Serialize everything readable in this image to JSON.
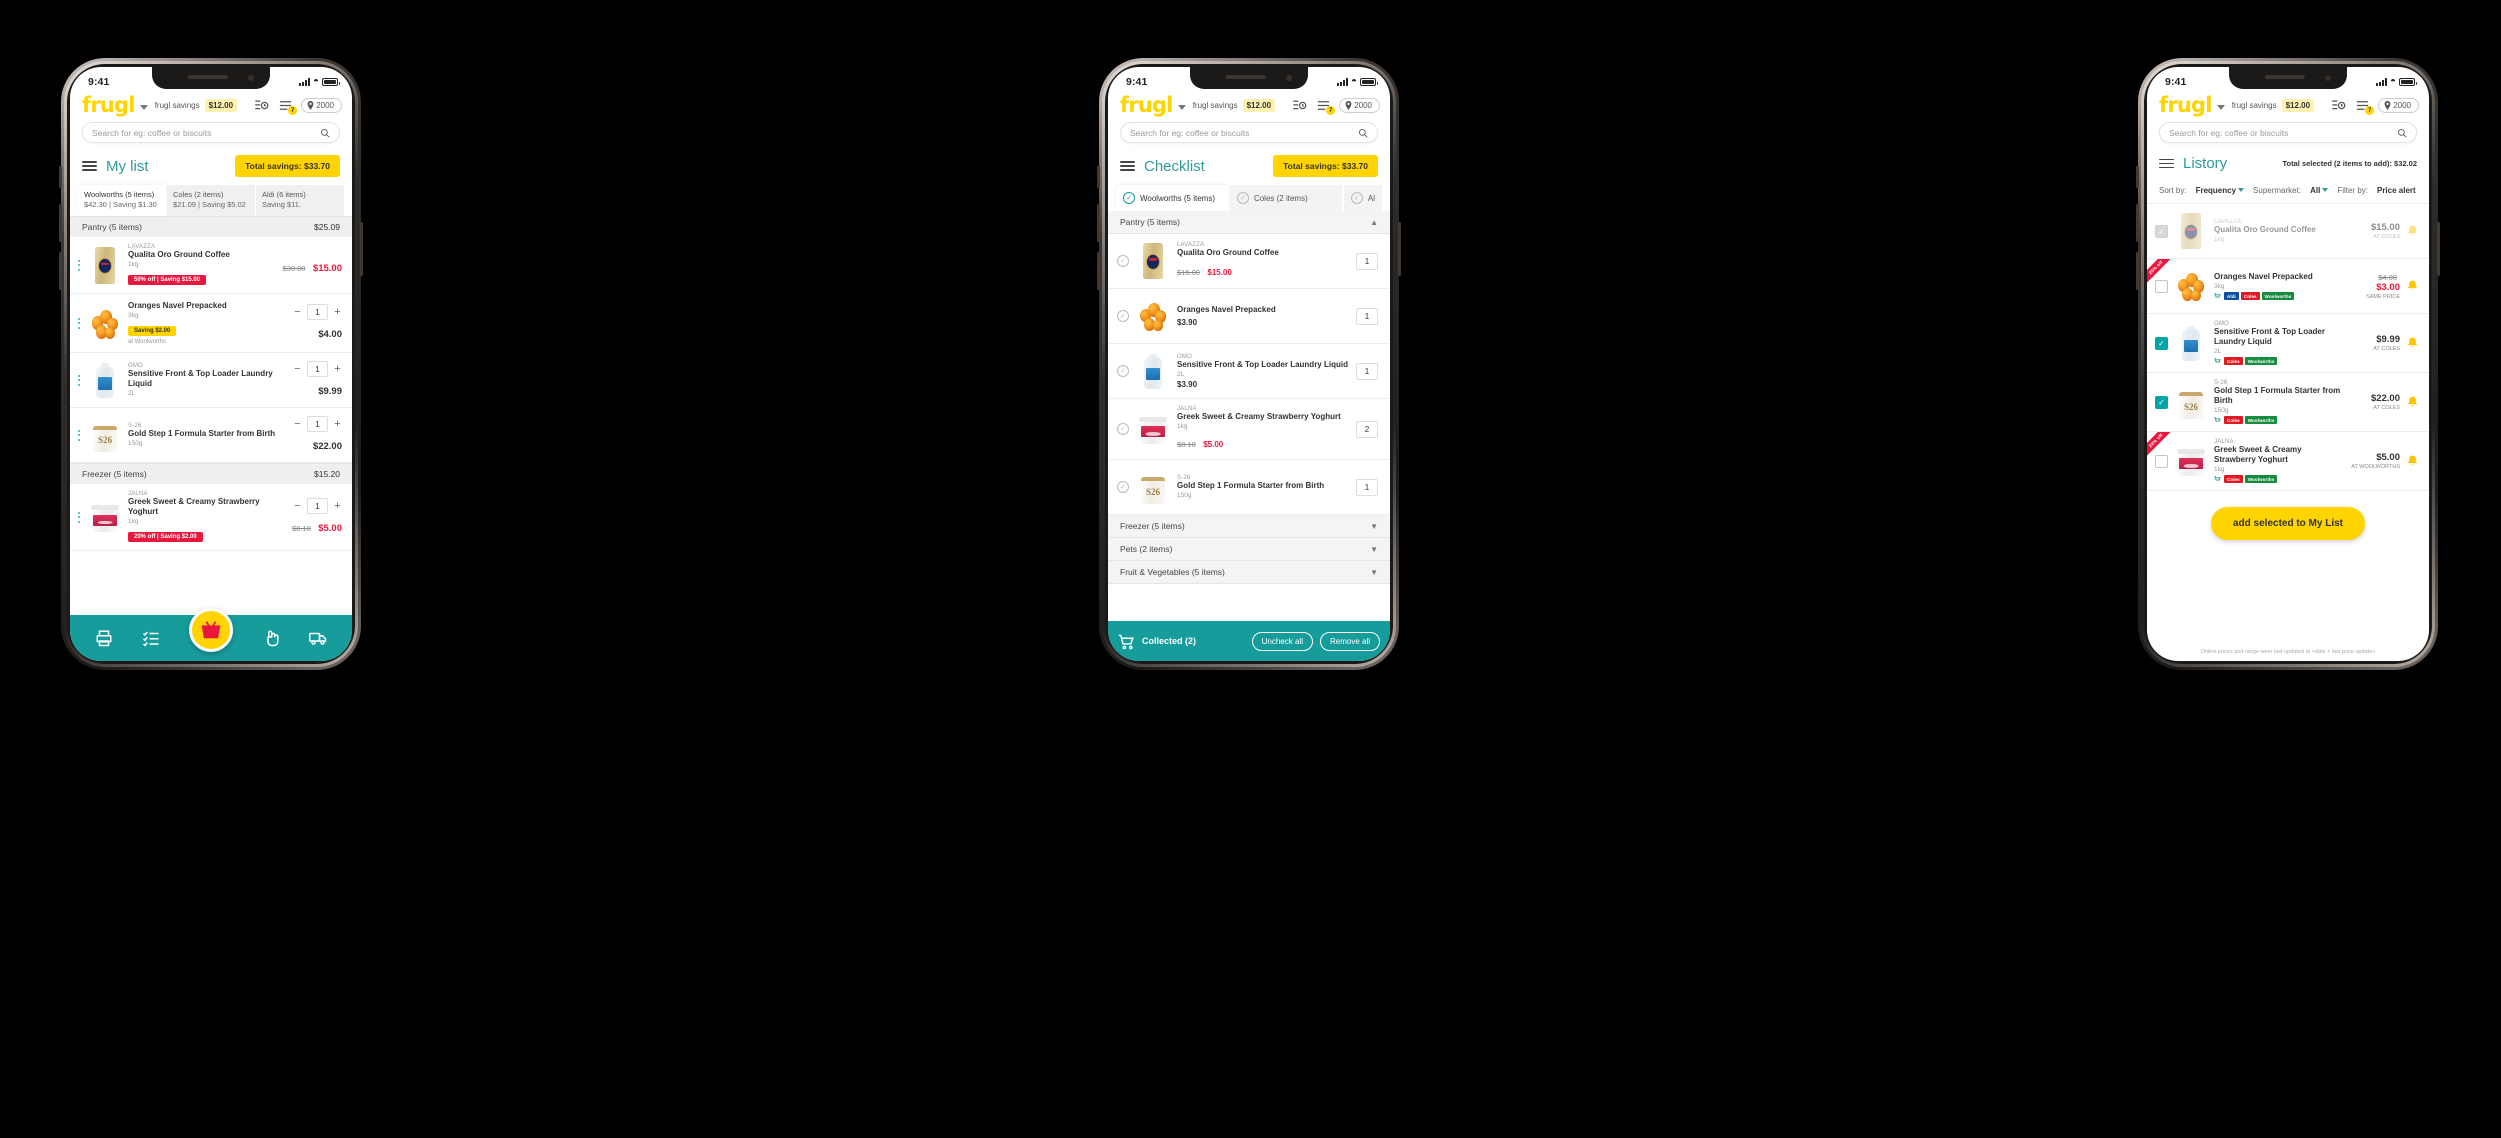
{
  "app": {
    "logo": "frugl",
    "savings_label": "frugl savings",
    "savings_amount": "$12.00",
    "postcode": "2000",
    "search_placeholder": "Search for eg: coffee or biscuits",
    "list_badge": "7",
    "cart_badge": "7",
    "status_time": "9:41",
    "accent_teal": "#179C9C",
    "accent_yellow": "#FFD400",
    "accent_red": "#E8173D"
  },
  "phone1": {
    "title": "My list",
    "savings_button": "Total savings: $33.70",
    "store_tabs": [
      {
        "name": "Woolworths (5 items)",
        "detail": "$42.30 | Saving $1.30",
        "active": true
      },
      {
        "name": "Coles (2 items)",
        "detail": "$21.09 | Saving $5.02",
        "active": false
      },
      {
        "name": "Aldi (6 items)",
        "detail": "Saving $11.",
        "active": false
      }
    ],
    "categories": [
      {
        "name": "Pantry (5 items)",
        "total": "$25.09",
        "items": [
          {
            "brand": "LAVAZZA",
            "name": "Qualita Oro Ground Coffee",
            "size": "1kg",
            "tag": "50% off  |  Saving $15.00",
            "tag_style": "red",
            "old_price": "$30.00",
            "price": "$15.00",
            "art": "coffee",
            "qty": null
          },
          {
            "brand": "",
            "name": "Oranges Navel Prepacked",
            "size": "3kg",
            "tag": "Saving $2.00",
            "tag_style": "yellow",
            "note": "at Woolworths",
            "old_price": "",
            "price": "$4.00",
            "art": "oranges",
            "qty": "1"
          },
          {
            "brand": "OMO",
            "name": "Sensitive Front & Top Loader Laundry Liquid",
            "size": "2L",
            "tag": "",
            "old_price": "",
            "price": "$9.99",
            "art": "bottle",
            "qty": "1"
          },
          {
            "brand": "S-26",
            "name": "Gold Step 1 Formula Starter from Birth",
            "size": "150g",
            "tag": "",
            "old_price": "",
            "price": "$22.00",
            "art": "tin",
            "qty": "1"
          }
        ]
      },
      {
        "name": "Freezer (5 items)",
        "total": "$15.20",
        "items": [
          {
            "brand": "JALNA",
            "name": "Greek Sweet & Creamy Strawberry Yoghurt",
            "size": "1kg",
            "tag": "20% off  |  Saving $2.00",
            "tag_style": "red",
            "old_price": "$8.10",
            "price": "$5.00",
            "art": "yoghurt",
            "qty": "1"
          }
        ]
      }
    ],
    "nav_icons": [
      "print-icon",
      "list-icon",
      "basket-icon",
      "tap-icon",
      "delivery-icon"
    ]
  },
  "phone2": {
    "title": "Checklist",
    "savings_button": "Total savings: $33.70",
    "store_tabs": [
      {
        "name": "Woolworths (5 items)",
        "active": true
      },
      {
        "name": "Coles (2 items)",
        "active": false
      },
      {
        "name": "Al",
        "active": false
      }
    ],
    "open_category": {
      "name": "Pantry (5 items)",
      "chevron": "▲"
    },
    "items": [
      {
        "brand": "LAVAZZA",
        "name": "Qualita Oro Ground Coffee",
        "size": "",
        "old_price": "$15.00",
        "price": "$15.00",
        "art": "coffee",
        "qty": "1",
        "checked": false
      },
      {
        "brand": "",
        "name": "Oranges Navel Prepacked",
        "size": "",
        "old_price": "",
        "price": "$3.90",
        "art": "oranges",
        "qty": "1",
        "checked": false
      },
      {
        "brand": "OMO",
        "name": "Sensitive Front & Top Loader Laundry Liquid",
        "size": "2L",
        "old_price": "",
        "price": "$3.90",
        "art": "bottle",
        "qty": "1",
        "checked": false
      },
      {
        "brand": "JALNA",
        "name": "Greek Sweet & Creamy Strawberry Yoghurt",
        "size": "1kg",
        "old_price": "$8.10",
        "price": "$5.00",
        "art": "yoghurt",
        "qty": "2",
        "checked": false
      },
      {
        "brand": "S-26",
        "name": "Gold Step 1 Formula Starter from Birth",
        "size": "150g",
        "old_price": "",
        "price": "",
        "art": "tin",
        "qty": "1",
        "checked": false
      }
    ],
    "collapsed_categories": [
      {
        "name": "Freezer (5 items)",
        "chevron": "▼"
      },
      {
        "name": "Pets (2 items)",
        "chevron": "▼"
      },
      {
        "name": "Fruit & Vegetables (5 items)",
        "chevron": "▼"
      }
    ],
    "bottom_bar": {
      "collected_label": "Collected (2)",
      "uncheck_label": "Uncheck all",
      "remove_label": "Remove all"
    }
  },
  "phone3": {
    "title": "Listory",
    "total_selected": "Total selected (2 items to add): $32.02",
    "filters": {
      "sort_label": "Sort by:",
      "sort_value": "Frequency",
      "supermarket_label": "Supermarket:",
      "supermarket_value": "All",
      "filter_label": "Filter by:",
      "filter_value": "Price alert"
    },
    "items": [
      {
        "brand": "LAVAZZA",
        "name": "Qualita Oro Ground Coffee",
        "size": "1kg",
        "price": "$15.00",
        "old_price": "",
        "store": "AT COLES",
        "art": "coffee",
        "state": "dim",
        "corner": "",
        "tags": [],
        "dimmed": true
      },
      {
        "brand": "",
        "name": "Oranges Navel Prepacked",
        "size": "3kg",
        "price": "$3.00",
        "old_price": "$4.00",
        "store": "SAME PRICE",
        "art": "oranges",
        "state": "unchecked",
        "corner": "25% off",
        "tags": [
          "Aldi",
          "Coles",
          "Woolworths"
        ],
        "dimmed": false
      },
      {
        "brand": "OMO",
        "name": "Sensitive Front & Top Loader Laundry Liquid",
        "size": "2L",
        "price": "$9.99",
        "old_price": "",
        "store": "AT COLES",
        "art": "bottle",
        "state": "checked",
        "corner": "",
        "tags": [
          "Coles",
          "Woolworths"
        ],
        "dimmed": false
      },
      {
        "brand": "S-26",
        "name": "Gold Step 1 Formula Starter from Birth",
        "size": "150g",
        "price": "$22.00",
        "old_price": "",
        "store": "AT COLES",
        "art": "tin",
        "state": "checked",
        "corner": "",
        "tags": [
          "Coles",
          "Woolworths"
        ],
        "dimmed": false
      },
      {
        "brand": "JALNA",
        "name": "Greek Sweet & Creamy Strawberry Yoghurt",
        "size": "1kg",
        "price": "$5.00",
        "old_price": "",
        "store": "AT WOOLWORTHS",
        "art": "yoghurt",
        "state": "unchecked",
        "corner": "20% off",
        "tags": [
          "Coles",
          "Woolworths"
        ],
        "dimmed": false
      }
    ],
    "add_button": "add selected to My List",
    "footnote": "Online prices and range were last updated at <date + last price update>"
  }
}
